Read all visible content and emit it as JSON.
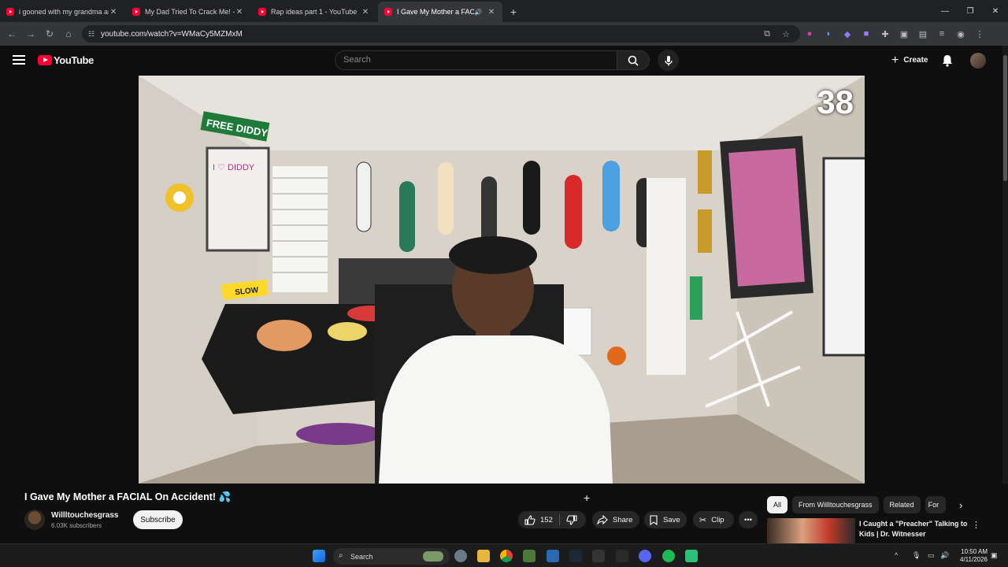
{
  "browser": {
    "tabs": [
      {
        "title": "i gooned with my grandma ash",
        "active": false
      },
      {
        "title": "My Dad Tried To Crack Me! - Yo",
        "active": false
      },
      {
        "title": "Rap ideas part 1 - YouTube",
        "active": false
      },
      {
        "title": "I Gave My Mother a FACIAL",
        "active": true
      }
    ],
    "url": "youtube.com/watch?v=WMaCy5MZMxM"
  },
  "header": {
    "logo_text": "YouTube",
    "search_placeholder": "Search",
    "create_label": "Create"
  },
  "video": {
    "overlay_counter": "38",
    "scene_texts": {
      "sign_top": "FREE DIDDY",
      "poster_text": "I ♡ DIDDY",
      "slow_sign": "SLOW"
    }
  },
  "meta": {
    "title": "I Gave My Mother a FACIAL On Accident! 💦",
    "channel": "Willltouchesgrass",
    "subscribers": "6.03K subscribers",
    "subscribe_label": "Subscribe",
    "likes": "152",
    "share_label": "Share",
    "save_label": "Save",
    "clip_label": "Clip"
  },
  "sidebar": {
    "chips": [
      "All",
      "From Willltouchesgrass",
      "Related",
      "For"
    ],
    "recommended": [
      {
        "title": "I Caught a \"Preacher\" Talking to Kids | Dr. Witnesser"
      }
    ]
  },
  "taskbar": {
    "search_label": "Search",
    "time": "10:50 AM",
    "date": "4/11/2026"
  },
  "colors": {
    "accent": "#ff0033",
    "background": "#0f0f0f"
  }
}
